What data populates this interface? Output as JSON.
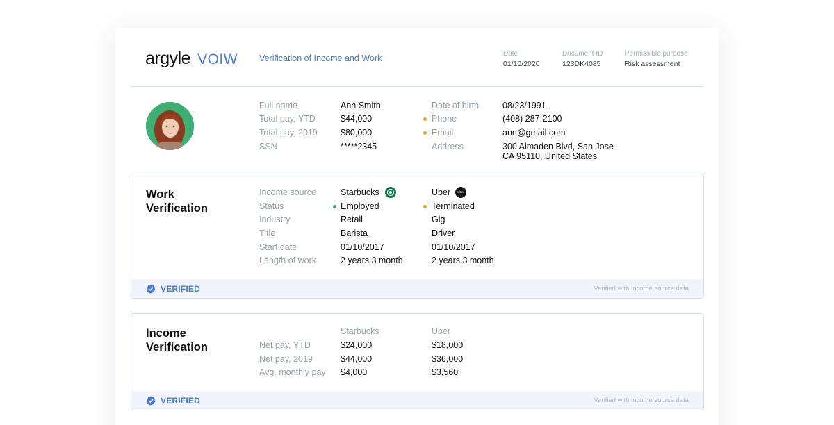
{
  "header": {
    "brand": "argyle",
    "product": "VOIW",
    "document_title": "Verification of Income and Work",
    "meta": {
      "date_label": "Date",
      "date_value": "01/10/2020",
      "docid_label": "Document ID",
      "docid_value": "123DK4085",
      "purpose_label": "Permissible purpose",
      "purpose_value": "Risk assessment"
    }
  },
  "profile": {
    "left": [
      {
        "label": "Full name",
        "value": "Ann Smith"
      },
      {
        "label": "Total pay, YTD",
        "value": "$44,000"
      },
      {
        "label": "Total pay, 2019",
        "value": "$80,000"
      },
      {
        "label": "SSN",
        "value": "*****2345"
      }
    ],
    "right": [
      {
        "label": "Date of birth",
        "value": "08/23/1991"
      },
      {
        "label": "Phone",
        "value": "(408) 287-2100"
      },
      {
        "label": "Email",
        "value": "ann@gmail.com"
      },
      {
        "label": "Address",
        "value": "300 Almaden Blvd, San Jose",
        "value2": "CA 95110, United States"
      }
    ]
  },
  "work": {
    "title_line1": "Work",
    "title_line2": "Verification",
    "labels": [
      "Income source",
      "Status",
      "Industry",
      "Title",
      "Start date",
      "Length of work"
    ],
    "source1": {
      "name": "Starbucks",
      "status": "Employed",
      "industry": "Retail",
      "title": "Barista",
      "start": "01/10/2017",
      "length": "2 years 3 month"
    },
    "source2": {
      "name": "Uber",
      "logo_text": "Uber",
      "status": "Terminated",
      "industry": "Gig",
      "title": "Driver",
      "start": "01/10/2017",
      "length": "2 years 3 month"
    },
    "verified_label": "VERIFIED",
    "verified_note": "Verified with income source data"
  },
  "income": {
    "title_line1": "Income",
    "title_line2": "Verification",
    "col1": "Starbucks",
    "col2": "Uber",
    "labels": [
      "Net pay, YTD",
      "Net pay, 2019",
      "Avg. monthly pay"
    ],
    "col1_values": [
      "$24,000",
      "$44,000",
      "$4,000"
    ],
    "col2_values": [
      "$18,000",
      "$36,000",
      "$3,560"
    ],
    "verified_label": "VERIFIED",
    "verified_note": "Verified with income source data"
  },
  "colors": {
    "accent": "#4a7bd2",
    "status_green": "#2fb170",
    "status_orange": "#f0a020"
  }
}
